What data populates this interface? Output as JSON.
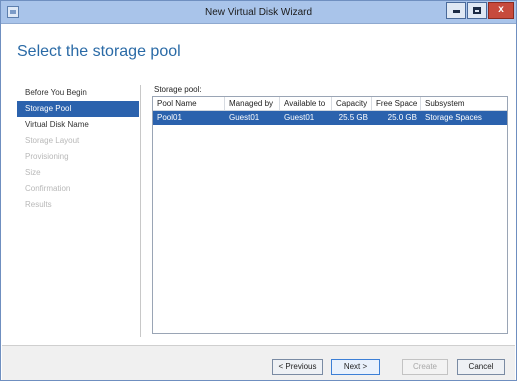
{
  "window": {
    "title": "New Virtual Disk Wizard"
  },
  "page": {
    "title": "Select the storage pool"
  },
  "nav": {
    "items": [
      {
        "label": "Before You Begin",
        "state": "normal"
      },
      {
        "label": "Storage Pool",
        "state": "selected"
      },
      {
        "label": "Virtual Disk Name",
        "state": "normal"
      },
      {
        "label": "Storage Layout",
        "state": "disabled"
      },
      {
        "label": "Provisioning",
        "state": "disabled"
      },
      {
        "label": "Size",
        "state": "disabled"
      },
      {
        "label": "Confirmation",
        "state": "disabled"
      },
      {
        "label": "Results",
        "state": "disabled"
      }
    ]
  },
  "storage_pool": {
    "label": "Storage pool:",
    "columns": [
      "Pool Name",
      "Managed by",
      "Available to",
      "Capacity",
      "Free Space",
      "Subsystem"
    ],
    "rows": [
      {
        "pool_name": "Pool01",
        "managed_by": "Guest01",
        "available_to": "Guest01",
        "capacity": "25.5 GB",
        "free_space": "25.0 GB",
        "subsystem": "Storage Spaces",
        "selected": true
      }
    ]
  },
  "buttons": {
    "previous": "< Previous",
    "next": "Next >",
    "create": "Create",
    "cancel": "Cancel"
  },
  "colors": {
    "selection": "#2b62ad",
    "title_text": "#2a6aa6",
    "titlebar": "#a9c4ea",
    "close_button": "#c74a3c"
  }
}
